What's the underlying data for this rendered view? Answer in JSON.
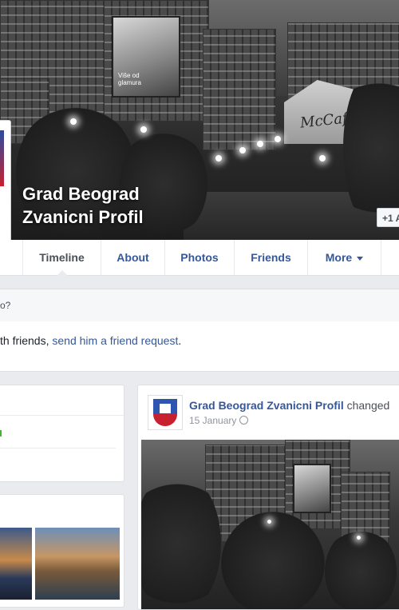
{
  "cover": {
    "title_line1": "Grad Beograd",
    "title_line2": "Zvanicni Profil",
    "sign_text": "McCafé",
    "billboard_text": "Više od glamura",
    "add_friend_label": "+1 A"
  },
  "nav": {
    "tabs": [
      {
        "label": "Timeline",
        "active": true
      },
      {
        "label": "About"
      },
      {
        "label": "Photos"
      },
      {
        "label": "Friends"
      },
      {
        "label": "More"
      }
    ]
  },
  "prompt_band": {
    "text": "o?"
  },
  "friend_band": {
    "prefix": "th friends, ",
    "link": "send him a friend request",
    "suffix": "."
  },
  "post": {
    "author": "Grad Beograd Zvanicni Profil",
    "action": " changed",
    "date": "15 January"
  },
  "colors": {
    "link": "#365899",
    "background": "#e9ebee",
    "border": "#dddfe2"
  }
}
